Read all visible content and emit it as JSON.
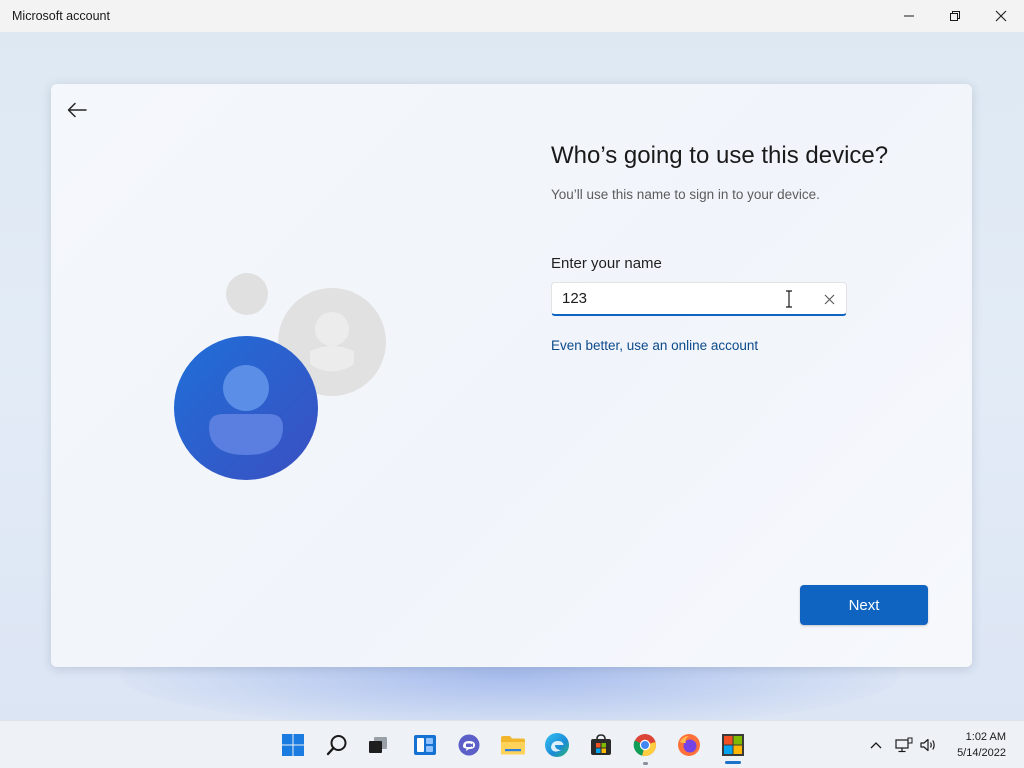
{
  "window": {
    "title": "Microsoft account",
    "controls": {
      "minimize_icon": "minimize-icon",
      "restore_icon": "restore-icon",
      "close_icon": "close-icon"
    }
  },
  "setup": {
    "heading": "Who’s going to use this device?",
    "subtitle": "You’ll use this name to sign in to your device.",
    "name_label": "Enter your name",
    "name_value": "123",
    "online_link": "Even better, use an online account",
    "next_label": "Next"
  },
  "taskbar": {
    "apps": [
      "start",
      "search",
      "task-view",
      "widgets",
      "chat",
      "file-explorer",
      "edge",
      "store",
      "chrome",
      "firefox",
      "oobe-active-app"
    ],
    "time": "1:02 AM",
    "date": "5/14/2022"
  },
  "colors": {
    "accent": "#0f64c1",
    "link": "#0c4a8a",
    "avatar_blue": "#2e63cf",
    "avatar_gray": "#dcdcdc"
  }
}
